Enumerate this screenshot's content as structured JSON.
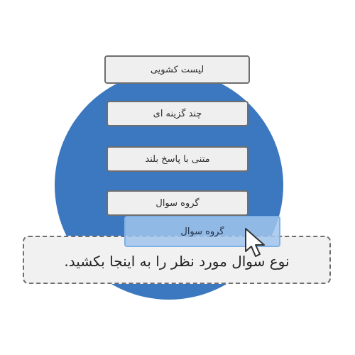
{
  "question_types": [
    {
      "label": "لیست کشویی"
    },
    {
      "label": "چند گزینه ای"
    },
    {
      "label": "متنی با پاسخ بلند"
    },
    {
      "label": "گروه سوال"
    }
  ],
  "dragging_item": {
    "label": "گروه سوال"
  },
  "drop_zone": {
    "text": "نوع سوال مورد نظر را به اینجا بکشید."
  },
  "colors": {
    "circle": "#3c78c0",
    "ghost": "#a0c4ec",
    "button_bg": "#efefef"
  },
  "icons": {
    "cursor": "arrow-pointer-icon"
  }
}
